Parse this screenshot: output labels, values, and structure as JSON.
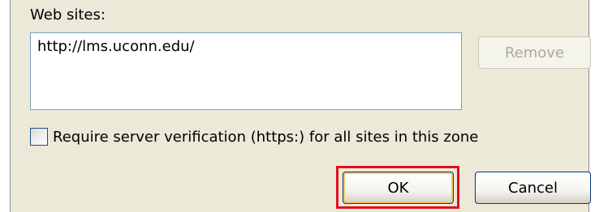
{
  "websites_label": "Web sites:",
  "sites": [
    "http://lms.uconn.edu/"
  ],
  "remove_button": "Remove",
  "require_https_label": "Require server verification (https:) for all sites in this zone",
  "require_https_checked": false,
  "ok_button": "OK",
  "cancel_button": "Cancel",
  "highlight_color": "#e0101e"
}
